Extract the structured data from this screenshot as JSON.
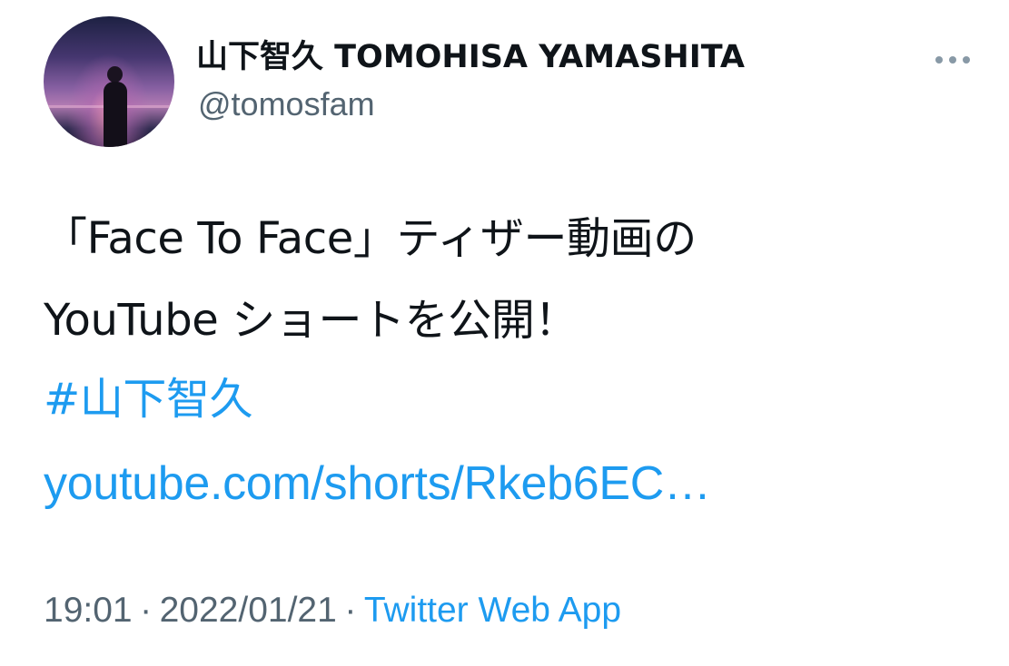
{
  "tweet": {
    "author": {
      "name": "山下智久 TOMOHISA YAMASHITA",
      "handle": "@tomosfam"
    },
    "more_menu": {
      "icon": "more-horizontal-icon"
    },
    "content": {
      "line_1": "「Face To Face」ティザー動画の",
      "line_2": "YouTube ショートを公開！",
      "hashtag": "#山下智久",
      "link_text": "youtube.com/shorts/Rkeb6EC…"
    },
    "metadata": {
      "time": "19:01",
      "separator": "·",
      "date": "2022/01/21",
      "source": "Twitter Web App"
    }
  },
  "colors": {
    "text": "#0f1419",
    "secondary_text": "#536471",
    "link": "#1d9bf0",
    "icon": "#8899a6",
    "background": "#ffffff"
  }
}
